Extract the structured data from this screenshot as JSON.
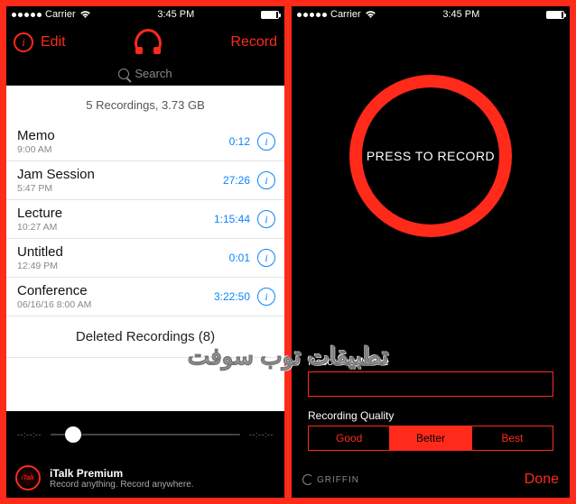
{
  "statusbar": {
    "carrier": "Carrier",
    "time": "3:45 PM"
  },
  "left": {
    "header": {
      "edit": "Edit",
      "record": "Record"
    },
    "search_placeholder": "Search",
    "summary": "5 Recordings, 3.73 GB",
    "recordings": [
      {
        "title": "Memo",
        "sub": "9:00 AM",
        "dur": "0:12"
      },
      {
        "title": "Jam Session",
        "sub": "5:47 PM",
        "dur": "27:26"
      },
      {
        "title": "Lecture",
        "sub": "10:27 AM",
        "dur": "1:15:44"
      },
      {
        "title": "Untitled",
        "sub": "12:49 PM",
        "dur": "0:01"
      },
      {
        "title": "Conference",
        "sub": "06/16/16 8:00 AM",
        "dur": "3:22:50"
      }
    ],
    "deleted": "Deleted Recordings (8)",
    "player": {
      "elapsed": "--:--:--",
      "remaining": "--:--:--"
    },
    "promo": {
      "title": "iTalk Premium",
      "tag": "Record anything. Record anywhere."
    }
  },
  "right": {
    "press": "PRESS TO RECORD",
    "name_label": "Recording Name",
    "name_value": "",
    "quality_label": "Recording Quality",
    "quality": [
      "Good",
      "Better",
      "Best"
    ],
    "quality_selected": 1,
    "brand": "GRIFFIN",
    "done": "Done"
  },
  "watermark": "تطبيقات توب سوفت"
}
